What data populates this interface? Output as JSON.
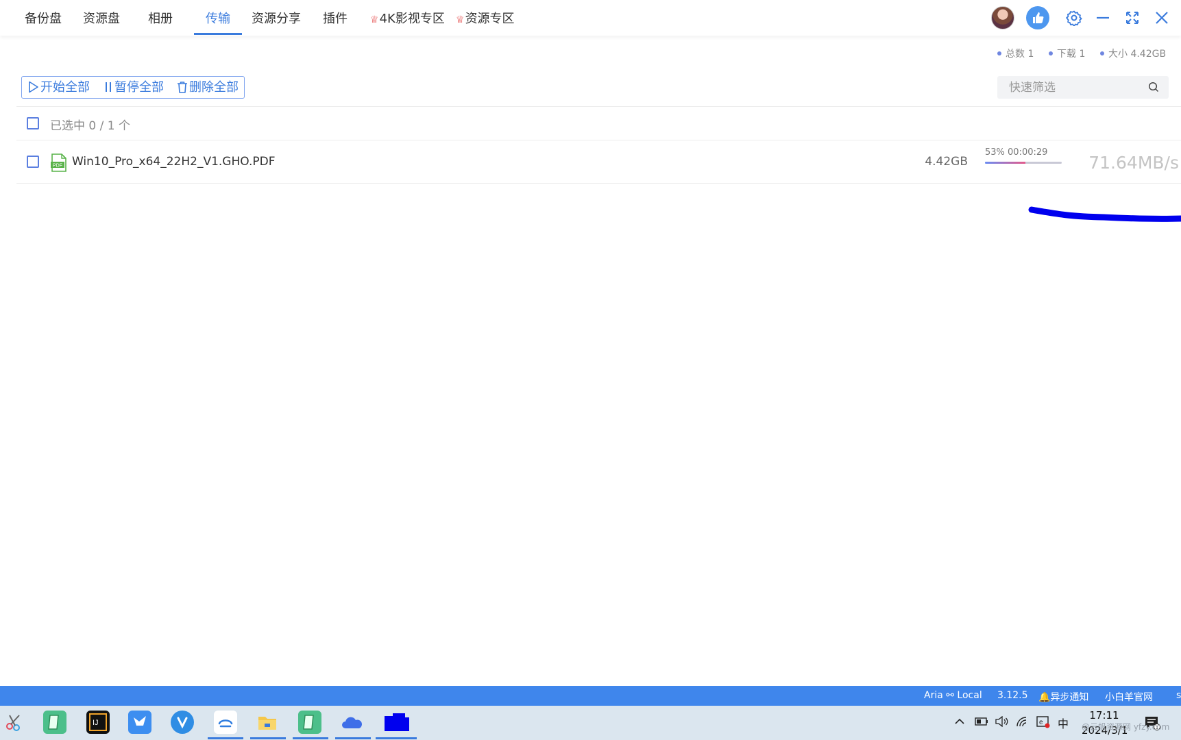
{
  "nav": {
    "items": [
      "备份盘",
      "资源盘",
      "相册",
      "传输",
      "资源分享",
      "插件"
    ],
    "active": "传输",
    "vip_items": [
      "4K影视专区",
      "资源专区"
    ]
  },
  "window_icons": [
    "avatar",
    "like-icon",
    "gear-icon",
    "minimize-icon",
    "fullscreen-icon",
    "close-icon"
  ],
  "stats": {
    "total": "总数 1",
    "download": "下载 1",
    "size": "大小 4.42GB"
  },
  "toolbar": {
    "start_all": "开始全部",
    "pause_all": "暂停全部",
    "delete_all": "删除全部"
  },
  "search": {
    "placeholder": "快速筛选"
  },
  "selection": {
    "text": "已选中 0 / 1 个"
  },
  "file": {
    "name": "Win10_Pro_x64_22H2_V1.GHO.PDF",
    "type_badge": "PDF",
    "size": "4.42GB",
    "progress_text": "53% 00:00:29",
    "progress": 0.53,
    "speed": "71.64MB/s"
  },
  "statusbar": {
    "engine": "Aria ⚯ Local",
    "version": "3.12.5",
    "notify": "异步通知",
    "site": "小白羊官网",
    "extra": "s"
  },
  "taskbar": {
    "tray_lang": "中",
    "time": "17:11",
    "date": "2024/3/1",
    "watermark": "@云帆资源网 yfzy.com",
    "notification_count": "1"
  },
  "colors": {
    "accent": "#3a7bdd",
    "statusbar": "#3f86ec",
    "vip": "#e23b3b",
    "pdf_green": "#59b34a"
  }
}
